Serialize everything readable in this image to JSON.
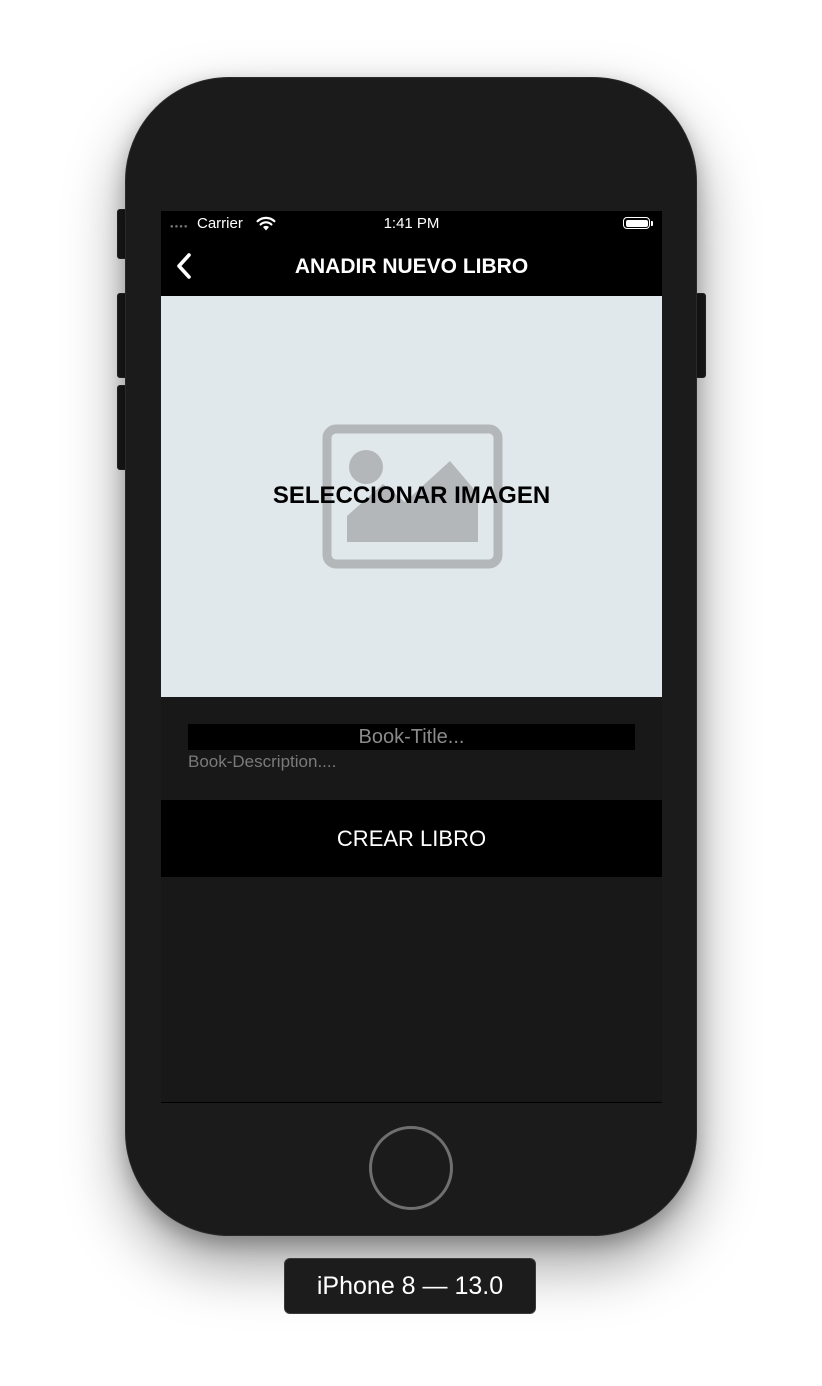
{
  "status_bar": {
    "carrier": "Carrier",
    "time": "1:41 PM",
    "signal_icon": "signal-dots-icon",
    "wifi_icon": "wifi-icon",
    "battery_icon": "battery-icon"
  },
  "nav": {
    "title": "ANADIR NUEVO LIBRO",
    "back_icon": "chevron-left-icon"
  },
  "image_picker": {
    "label": "SELECCIONAR IMAGEN",
    "icon": "image-placeholder-icon",
    "background": "#e1e8ec"
  },
  "form": {
    "title_placeholder": "Book-Title...",
    "title_value": "",
    "description_placeholder": "Book-Description....",
    "description_value": ""
  },
  "create_button": {
    "label": "CREAR LIBRO"
  },
  "simulator": {
    "device_label": "iPhone 8 — 13.0"
  },
  "colors": {
    "screen_background": "#181818",
    "bar_background": "#000000",
    "text_primary": "#ffffff",
    "placeholder_text": "#8a8a8a"
  }
}
